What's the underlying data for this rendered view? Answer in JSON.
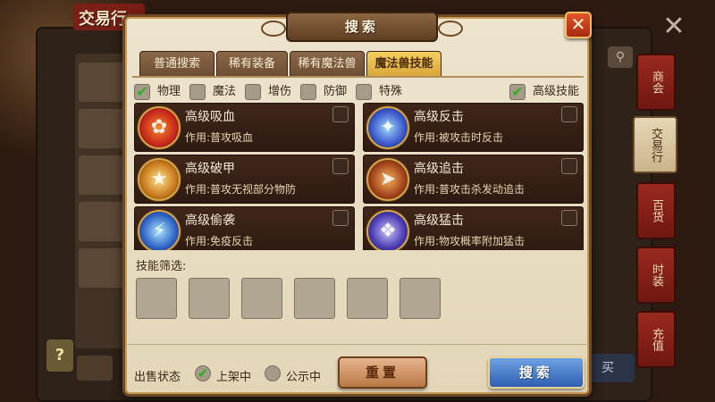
{
  "background": {
    "title": "交易行",
    "side_tabs": [
      "商会",
      "交易行",
      "百货",
      "时装",
      "充值"
    ],
    "active_side_tab": "交易行",
    "buy_label": "买",
    "help_label": "?"
  },
  "dialog": {
    "title": "搜索",
    "close_label": "✕",
    "tabs": [
      {
        "label": "普通搜索",
        "active": false
      },
      {
        "label": "稀有装备",
        "active": false
      },
      {
        "label": "稀有魔法兽",
        "active": false
      },
      {
        "label": "魔法兽技能",
        "active": true
      }
    ],
    "filters": [
      {
        "label": "物理",
        "checked": true
      },
      {
        "label": "魔法",
        "checked": false
      },
      {
        "label": "增伤",
        "checked": false
      },
      {
        "label": "防御",
        "checked": false
      },
      {
        "label": "特殊",
        "checked": false
      }
    ],
    "advanced_filter": {
      "label": "高级技能",
      "checked": true
    },
    "skills": [
      {
        "name": "高级吸血",
        "effect": "作用:普攻吸血",
        "icon": "blood-swirl-icon",
        "color": "#c8281c",
        "checked": false
      },
      {
        "name": "高级反击",
        "effect": "作用:被攻击时反击",
        "icon": "counter-strike-icon",
        "color": "#3a56c8",
        "checked": false
      },
      {
        "name": "高级破甲",
        "effect": "作用:普攻无视部分物防",
        "icon": "armor-break-icon",
        "color": "#c87a1c",
        "checked": false
      },
      {
        "name": "高级追击",
        "effect": "作用:普攻击杀发动追击",
        "icon": "pursuit-icon",
        "color": "#a0421a",
        "checked": false
      },
      {
        "name": "高级偷袭",
        "effect": "作用:免疫反击",
        "icon": "sneak-attack-icon",
        "color": "#2f62c4",
        "checked": false
      },
      {
        "name": "高级猛击",
        "effect": "作用:物攻概率附加猛击",
        "icon": "heavy-strike-icon",
        "color": "#4a3ab0",
        "checked": false
      }
    ],
    "skill_filter_label": "技能筛选:",
    "slot_count": 6,
    "sale_status_label": "出售状态",
    "status_options": [
      {
        "label": "上架中",
        "selected": true
      },
      {
        "label": "公示中",
        "selected": false
      }
    ],
    "reset_label": "重置",
    "search_label": "搜索"
  },
  "colors": {
    "check_green": "#2fae23",
    "active_tab": "#f4cf5c",
    "search_button": "#2f5fb2",
    "reset_button": "#b97745"
  }
}
